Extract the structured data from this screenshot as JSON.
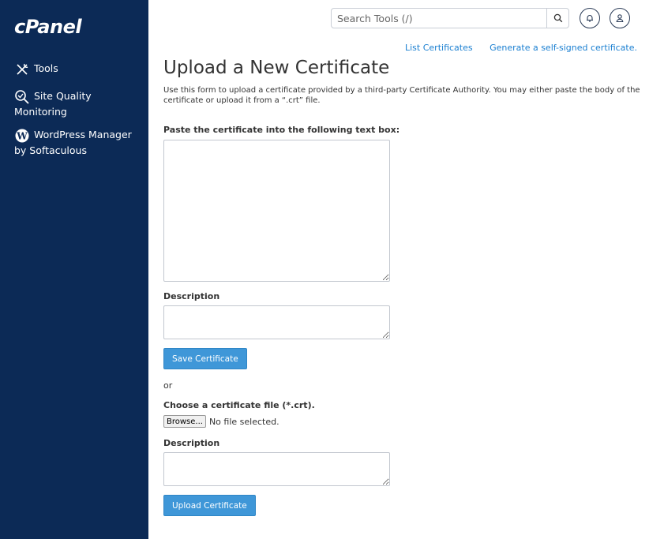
{
  "brand": {
    "logo_text": "cPanel"
  },
  "sidebar": {
    "items": [
      {
        "label": "Tools",
        "sublabel": "",
        "icon": "tools-icon"
      },
      {
        "label": "Site Quality",
        "sublabel": "Monitoring",
        "icon": "site-quality-icon"
      },
      {
        "label": "WordPress Manager",
        "sublabel": "by Softaculous",
        "icon": "wordpress-icon"
      }
    ]
  },
  "header": {
    "search_placeholder": "Search Tools (/)",
    "icons": [
      "search-icon",
      "bell-icon",
      "user-icon"
    ]
  },
  "main": {
    "links": {
      "list_certificates": "List Certificates",
      "generate_self_signed": "Generate a self-signed certificate."
    },
    "title": "Upload a New Certificate",
    "intro": "Use this form to upload a certificate provided by a third-party Certificate Authority. You may either paste the body of the certificate or upload it from a “.crt” file.",
    "paste_label": "Paste the certificate into the following text box:",
    "certificate_text": "",
    "description_label": "Description",
    "description_value": "",
    "save_button": "Save Certificate",
    "or_text": "or",
    "file_label": "Choose a certificate file (*.crt).",
    "browse_button": "Browse...",
    "file_status": "No file selected.",
    "description_label_2": "Description",
    "description_value_2": "",
    "upload_button": "Upload Certificate"
  },
  "colors": {
    "sidebar_bg": "#0c2a56",
    "primary_button": "#3f97d8",
    "link": "#1a7fd1"
  }
}
